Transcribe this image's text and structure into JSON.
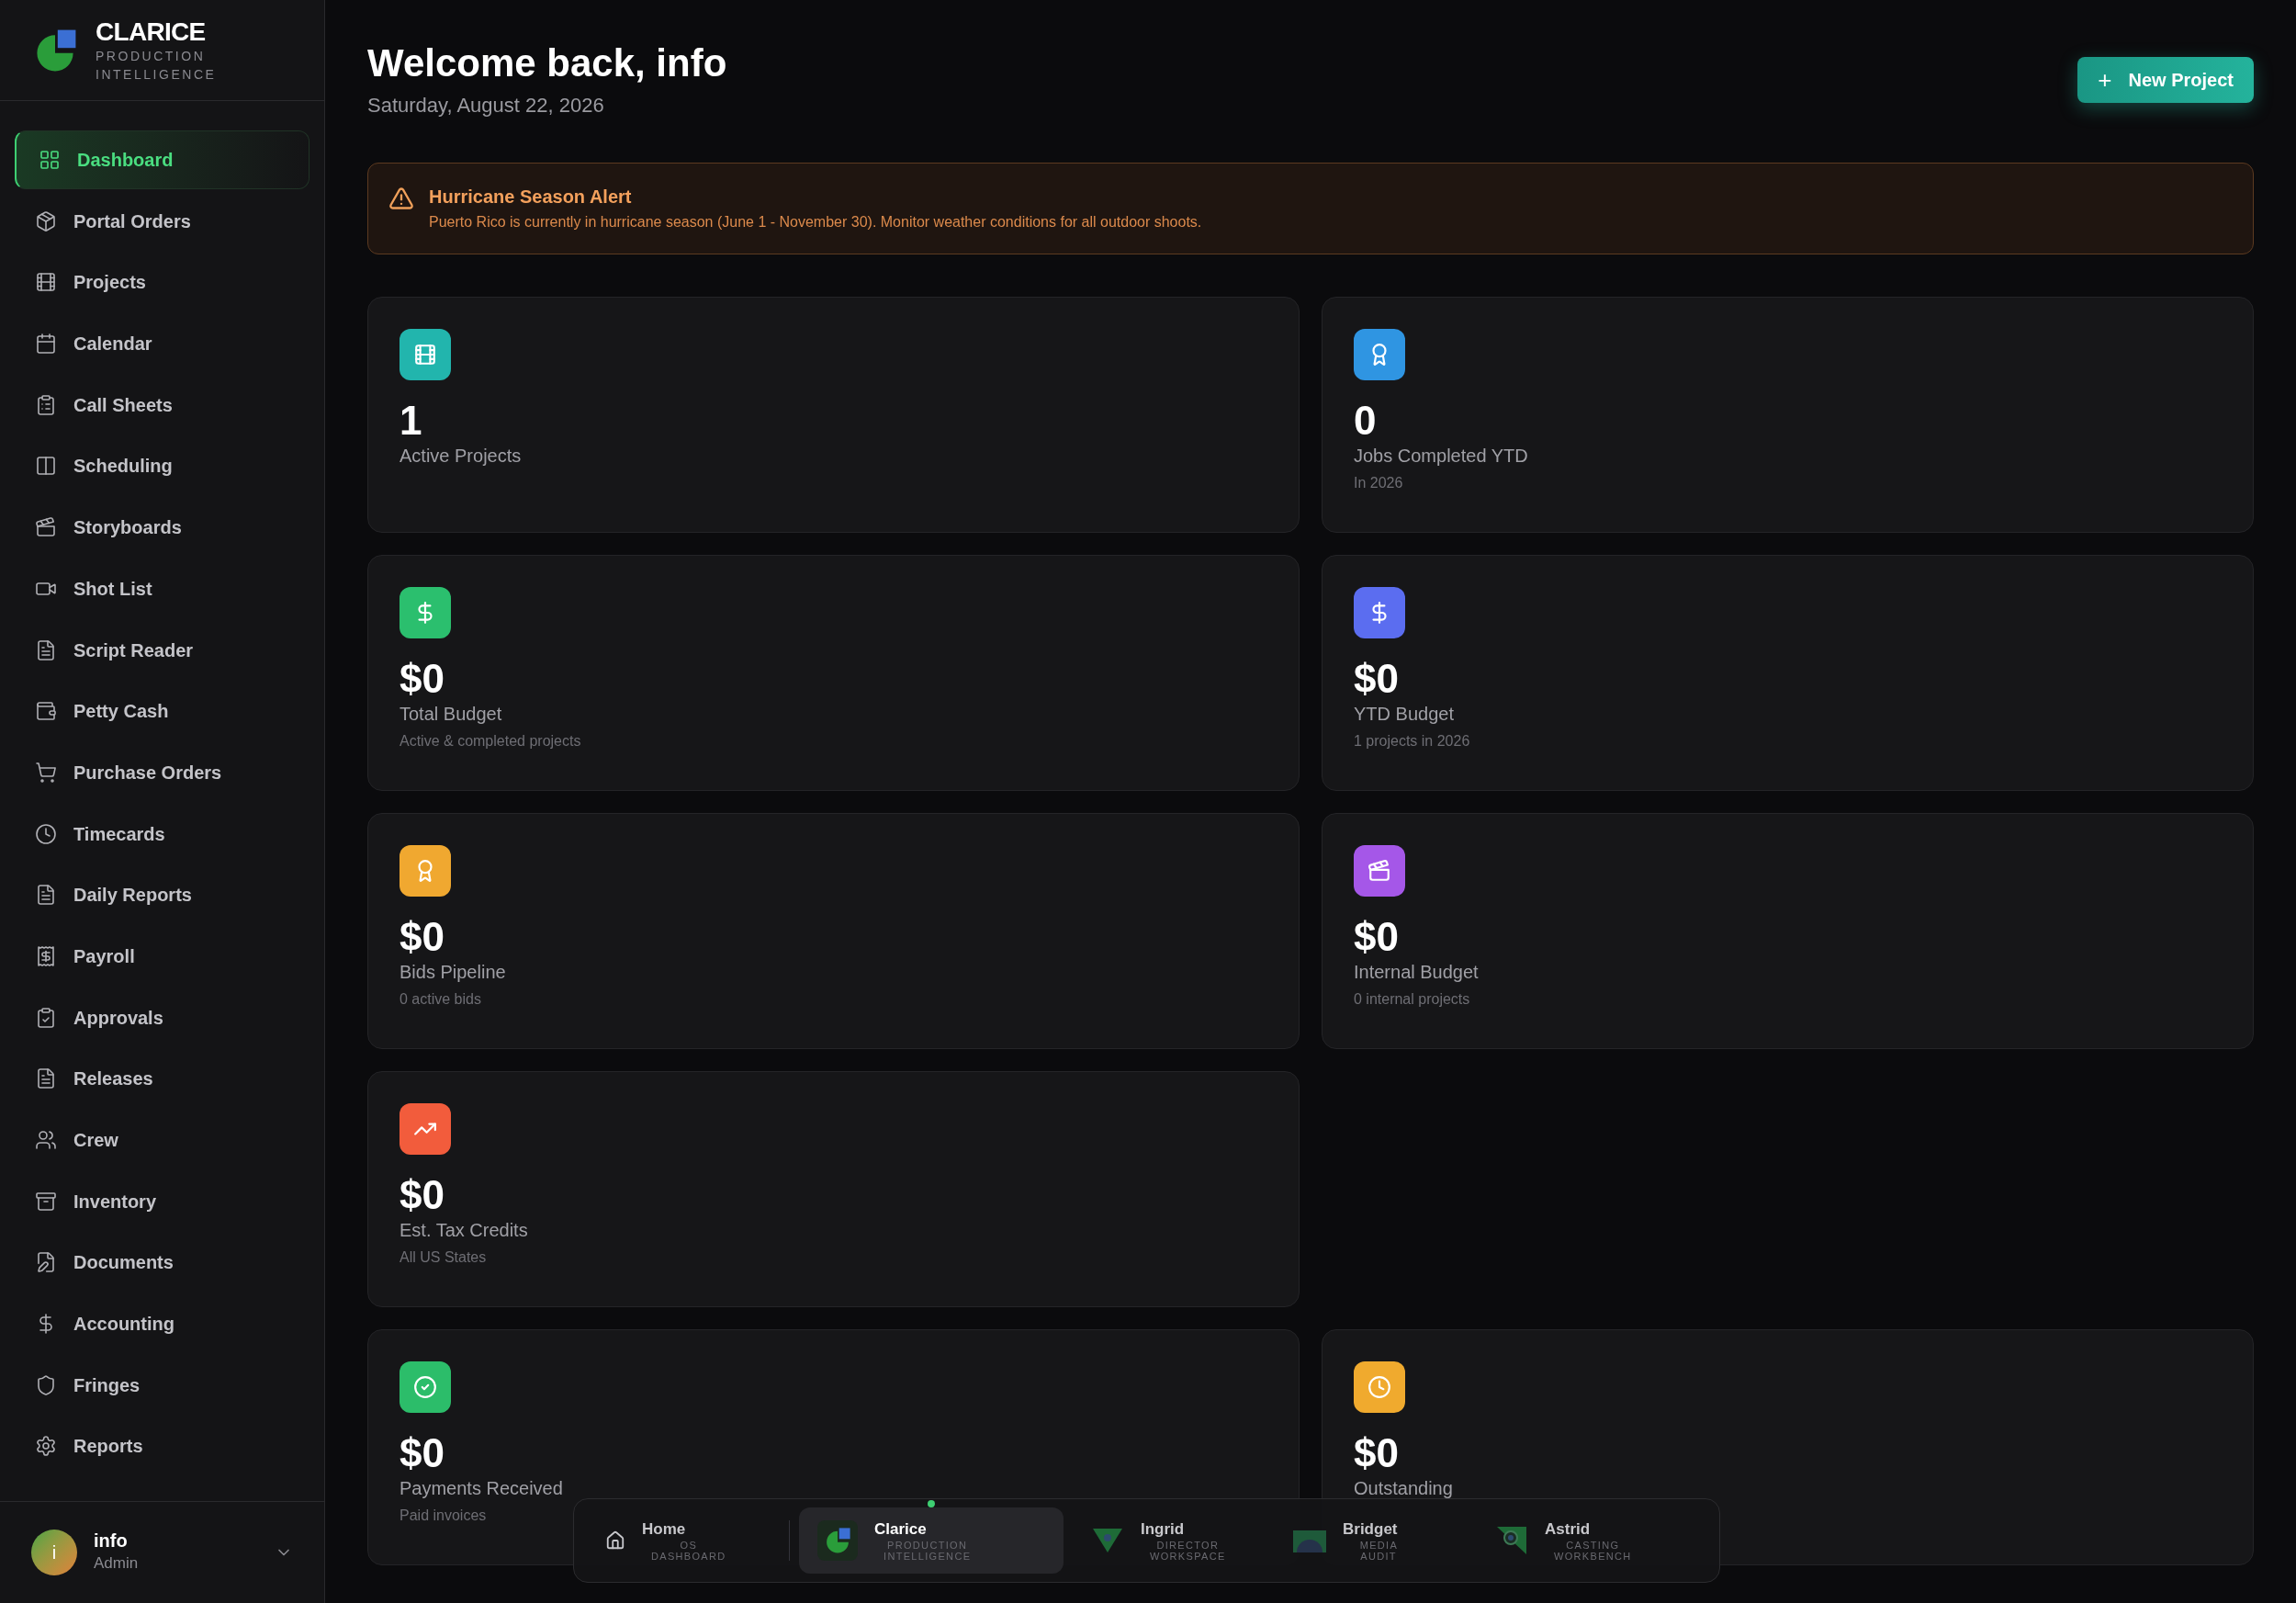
{
  "brand": {
    "name": "CLARICE",
    "tagline": "PRODUCTION INTELLIGENCE"
  },
  "sidebar": {
    "items": [
      {
        "label": "Dashboard",
        "selected": true
      },
      {
        "label": "Portal Orders",
        "selected": false
      },
      {
        "label": "Projects",
        "selected": false
      },
      {
        "label": "Calendar",
        "selected": false
      },
      {
        "label": "Call Sheets",
        "selected": false
      },
      {
        "label": "Scheduling",
        "selected": false
      },
      {
        "label": "Storyboards",
        "selected": false
      },
      {
        "label": "Shot List",
        "selected": false
      },
      {
        "label": "Script Reader",
        "selected": false
      },
      {
        "label": "Petty Cash",
        "selected": false
      },
      {
        "label": "Purchase Orders",
        "selected": false
      },
      {
        "label": "Timecards",
        "selected": false
      },
      {
        "label": "Daily Reports",
        "selected": false
      },
      {
        "label": "Payroll",
        "selected": false
      },
      {
        "label": "Approvals",
        "selected": false
      },
      {
        "label": "Releases",
        "selected": false
      },
      {
        "label": "Crew",
        "selected": false
      },
      {
        "label": "Inventory",
        "selected": false
      },
      {
        "label": "Documents",
        "selected": false
      },
      {
        "label": "Accounting",
        "selected": false
      },
      {
        "label": "Fringes",
        "selected": false
      },
      {
        "label": "Reports",
        "selected": false
      }
    ],
    "user": {
      "initial": "i",
      "name": "info",
      "role": "Admin"
    }
  },
  "header": {
    "title": "Welcome back, info",
    "date": "Saturday, August 22, 2026",
    "button": "New Project",
    "button_icon": "+"
  },
  "alert": {
    "title": "Hurricane Season Alert",
    "message": "Puerto Rico is currently in hurricane season (June 1 - November 30). Monitor weather conditions for all outdoor shoots."
  },
  "stat_rows": [
    [
      {
        "value": "1",
        "label": "Active Projects",
        "color": "#22b5ad"
      },
      {
        "value": "0",
        "label": "Jobs Completed YTD",
        "sub": "In 2026",
        "color": "#2f95e2"
      }
    ],
    [
      {
        "value": "$0",
        "label": "Total Budget",
        "sub": "Active & completed projects",
        "color": "#2bbf6e"
      },
      {
        "value": "$0",
        "label": "YTD Budget",
        "sub": "1 projects in 2026",
        "color": "#5b6df0"
      }
    ],
    [
      {
        "value": "$0",
        "label": "Bids Pipeline",
        "sub": "0 active bids",
        "color": "#f0a830"
      },
      {
        "value": "$0",
        "label": "Internal Budget",
        "sub": "0 internal projects",
        "color": "#a557e8"
      }
    ],
    [
      {
        "value": "$0",
        "label": "Est. Tax Credits",
        "sub": "All US States",
        "color": "#f25c3c"
      }
    ],
    [
      {
        "value": "$0",
        "label": "Payments Received",
        "sub": "Paid invoices",
        "color": "#2cbd6a"
      },
      {
        "value": "$0",
        "label": "Outstanding",
        "color": "#f0aa2e"
      }
    ]
  ],
  "dock": [
    {
      "name": "Home",
      "sub": "OS DASHBOARD",
      "selected": false
    },
    {
      "name": "Clarice",
      "sub": "PRODUCTION INTELLIGENCE",
      "selected": true
    },
    {
      "name": "Ingrid",
      "sub": "DIRECTOR WORKSPACE",
      "selected": false
    },
    {
      "name": "Bridget",
      "sub": "MEDIA AUDIT",
      "selected": false
    },
    {
      "name": "Astrid",
      "sub": "CASTING WORKBENCH",
      "selected": false
    }
  ]
}
